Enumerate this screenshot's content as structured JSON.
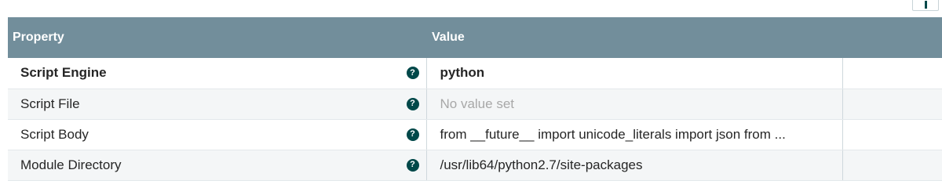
{
  "table": {
    "header": {
      "property": "Property",
      "value": "Value"
    },
    "rows": [
      {
        "name": "Script Engine",
        "value": "python",
        "help_icon": "question-circle-icon"
      },
      {
        "name": "Script File",
        "value": "No value set",
        "help_icon": "question-circle-icon"
      },
      {
        "name": "Script Body",
        "value": "from __future__ import unicode_literals import json from ...",
        "help_icon": "question-circle-icon"
      },
      {
        "name": "Module Directory",
        "value": "/usr/lib64/python2.7/site-packages",
        "help_icon": "question-circle-icon"
      }
    ]
  },
  "help_glyph": "?",
  "colors": {
    "header_bg": "#728e9b",
    "icon_bg": "#004849",
    "placeholder_text": "#a8a8a8"
  }
}
